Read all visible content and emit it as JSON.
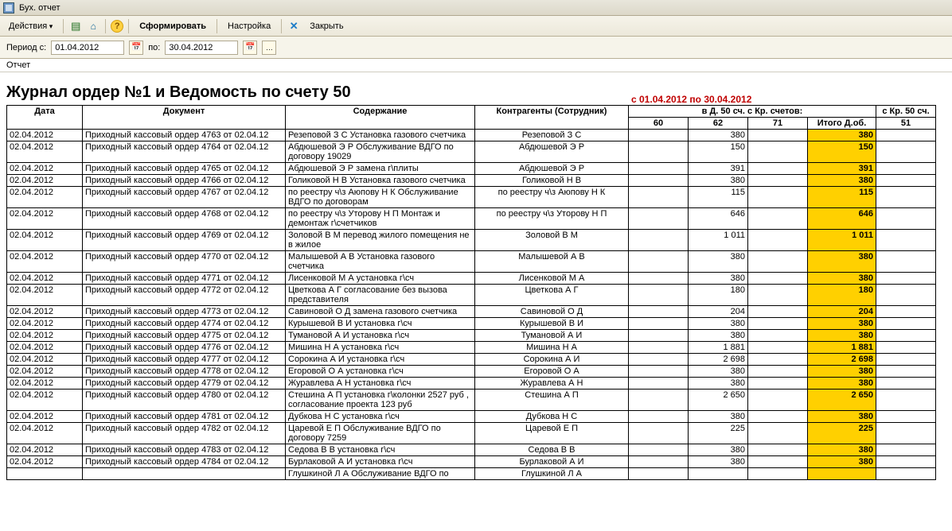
{
  "window": {
    "title": "Бух. отчет"
  },
  "toolbar": {
    "actions": "Действия",
    "form": "Сформировать",
    "settings": "Настройка",
    "close": "Закрыть"
  },
  "period": {
    "label_from": "Период с:",
    "from": "01.04.2012",
    "label_to": "по:",
    "to": "30.04.2012"
  },
  "report_tab": "Отчет",
  "report": {
    "title": "Журнал ордер №1 и Ведомость по счету 50",
    "date_range": "с 01.04.2012 по 30.04.2012",
    "group_left": "в Д. 50 сч. с Кр. счетов:",
    "group_right": "с Кр. 50 сч.",
    "headers": {
      "date": "Дата",
      "doc": "Документ",
      "desc": "Содержание",
      "contr": "Контрагенты (Сотрудник)",
      "a60": "60",
      "a62": "62",
      "a71": "71",
      "total": "Итого Д.об.",
      "a51": "51"
    }
  },
  "rows": [
    {
      "date": "02.04.2012",
      "doc": "Приходный кассовый ордер 4763 от 02.04.12",
      "desc": "Резеповой З С   Установка газового счетчика",
      "contr": "Резеповой З С",
      "a62": "380",
      "tot": "380"
    },
    {
      "date": "02.04.2012",
      "doc": "Приходный кассовый ордер 4764 от 02.04.12",
      "desc": "Абдюшевой  Э Р  Обслуживание ВДГО по договору 19029",
      "contr": "Абдюшевой  Э Р",
      "a62": "150",
      "tot": "150"
    },
    {
      "date": "02.04.2012",
      "doc": "Приходный кассовый ордер 4765 от 02.04.12",
      "desc": "Абдюшевой  Э Р    замена г\\плиты",
      "contr": "Абдюшевой  Э Р",
      "a62": "391",
      "tot": "391"
    },
    {
      "date": "02.04.2012",
      "doc": "Приходный кассовый ордер 4766 от 02.04.12",
      "desc": "Голиковой  Н В    Установка газового счетчика",
      "contr": "Голиковой  Н В",
      "a62": "380",
      "tot": "380"
    },
    {
      "date": "02.04.2012",
      "doc": "Приходный кассовый ордер 4767 от 02.04.12",
      "desc": "по реестру ч\\з  Аюпову Н К   Обслуживание ВДГО по договорам",
      "contr": "по реестру ч\\з Аюпову Н К",
      "a62": "115",
      "tot": "115"
    },
    {
      "date": "02.04.2012",
      "doc": "Приходный кассовый ордер 4768 от 02.04.12",
      "desc": "по реестру ч\\з  Уторову Н П  Монтаж и демонтаж г\\счетчиков",
      "contr": "по реестру ч\\з Уторову Н П",
      "a62": "646",
      "tot": "646"
    },
    {
      "date": "02.04.2012",
      "doc": "Приходный кассовый ордер 4769 от 02.04.12",
      "desc": "Золовой В М   перевод жилого помещения не в жилое",
      "contr": "Золовой В М",
      "a62": "1 011",
      "tot": "1 011"
    },
    {
      "date": "02.04.2012",
      "doc": "Приходный кассовый ордер 4770 от 02.04.12",
      "desc": "Малышевой А В    Установка газового счетчика",
      "contr": "Малышевой А В",
      "a62": "380",
      "tot": "380"
    },
    {
      "date": "02.04.2012",
      "doc": "Приходный кассовый ордер 4771 от 02.04.12",
      "desc": "Лисенковой  М А  установка г\\сч",
      "contr": "Лисенковой  М А",
      "a62": "380",
      "tot": "380"
    },
    {
      "date": "02.04.2012",
      "doc": "Приходный кассовый ордер 4772 от 02.04.12",
      "desc": "Цветкова  А Г   согласование без вызова представителя",
      "contr": "Цветкова  А Г",
      "a62": "180",
      "tot": "180"
    },
    {
      "date": "02.04.2012",
      "doc": "Приходный кассовый ордер 4773 от 02.04.12",
      "desc": "Савиновой О Д   замена  газового счетчика",
      "contr": "Савиновой О Д",
      "a62": "204",
      "tot": "204"
    },
    {
      "date": "02.04.2012",
      "doc": "Приходный кассовый ордер 4774 от 02.04.12",
      "desc": "Курышевой  В И   установка г\\сч",
      "contr": "Курышевой  В И",
      "a62": "380",
      "tot": "380"
    },
    {
      "date": "02.04.2012",
      "doc": "Приходный кассовый ордер 4775 от 02.04.12",
      "desc": "Тумановой  А И   установка г\\сч",
      "contr": "Тумановой А И",
      "a62": "380",
      "tot": "380"
    },
    {
      "date": "02.04.2012",
      "doc": "Приходный кассовый ордер 4776 от 02.04.12",
      "desc": "Мишина Н А    установка г\\сч",
      "contr": "Мишина Н А",
      "a62": "1 881",
      "tot": "1 881"
    },
    {
      "date": "02.04.2012",
      "doc": "Приходный кассовый ордер 4777 от 02.04.12",
      "desc": "Сорокина  А И    установка г\\сч",
      "contr": "Сорокина А И",
      "a62": "2 698",
      "tot": "2 698"
    },
    {
      "date": "02.04.2012",
      "doc": "Приходный кассовый ордер 4778 от 02.04.12",
      "desc": "Егоровой О А    установка г\\сч",
      "contr": "Егоровой О А",
      "a62": "380",
      "tot": "380"
    },
    {
      "date": "02.04.2012",
      "doc": "Приходный кассовый ордер 4779 от 02.04.12",
      "desc": "Журавлева А Н  установка г\\сч",
      "contr": "Журавлева А Н",
      "a62": "380",
      "tot": "380"
    },
    {
      "date": "02.04.2012",
      "doc": "Приходный кассовый ордер 4780 от 02.04.12",
      "desc": "Стешина А П установка г\\колонки  2527 руб , согласование  проекта 123 руб",
      "contr": "Стешина А П",
      "a62": "2 650",
      "tot": "2 650"
    },
    {
      "date": "02.04.2012",
      "doc": "Приходный кассовый ордер 4781 от 02.04.12",
      "desc": "Дубкова Н С  установка г\\сч",
      "contr": "Дубкова Н С",
      "a62": "380",
      "tot": "380"
    },
    {
      "date": "02.04.2012",
      "doc": "Приходный кассовый ордер 4782 от 02.04.12",
      "desc": "Царевой Е П  Обслуживание ВДГО по договору 7259",
      "contr": "Царевой Е П",
      "a62": "225",
      "tot": "225"
    },
    {
      "date": "02.04.2012",
      "doc": "Приходный кассовый ордер 4783 от 02.04.12",
      "desc": "Седова  В В   установка г\\сч",
      "contr": "Седова  В В",
      "a62": "380",
      "tot": "380"
    },
    {
      "date": "02.04.2012",
      "doc": "Приходный кассовый ордер 4784 от 02.04.12",
      "desc": "Бурлаковой  А И   установка г\\сч",
      "contr": "Бурлаковой А И",
      "a62": "380",
      "tot": "380"
    },
    {
      "date": "",
      "doc": "",
      "desc": "Глушкиной Л А  Обслуживание ВДГО по",
      "contr": "Глушкиной Л А",
      "a62": "",
      "tot": ""
    }
  ]
}
